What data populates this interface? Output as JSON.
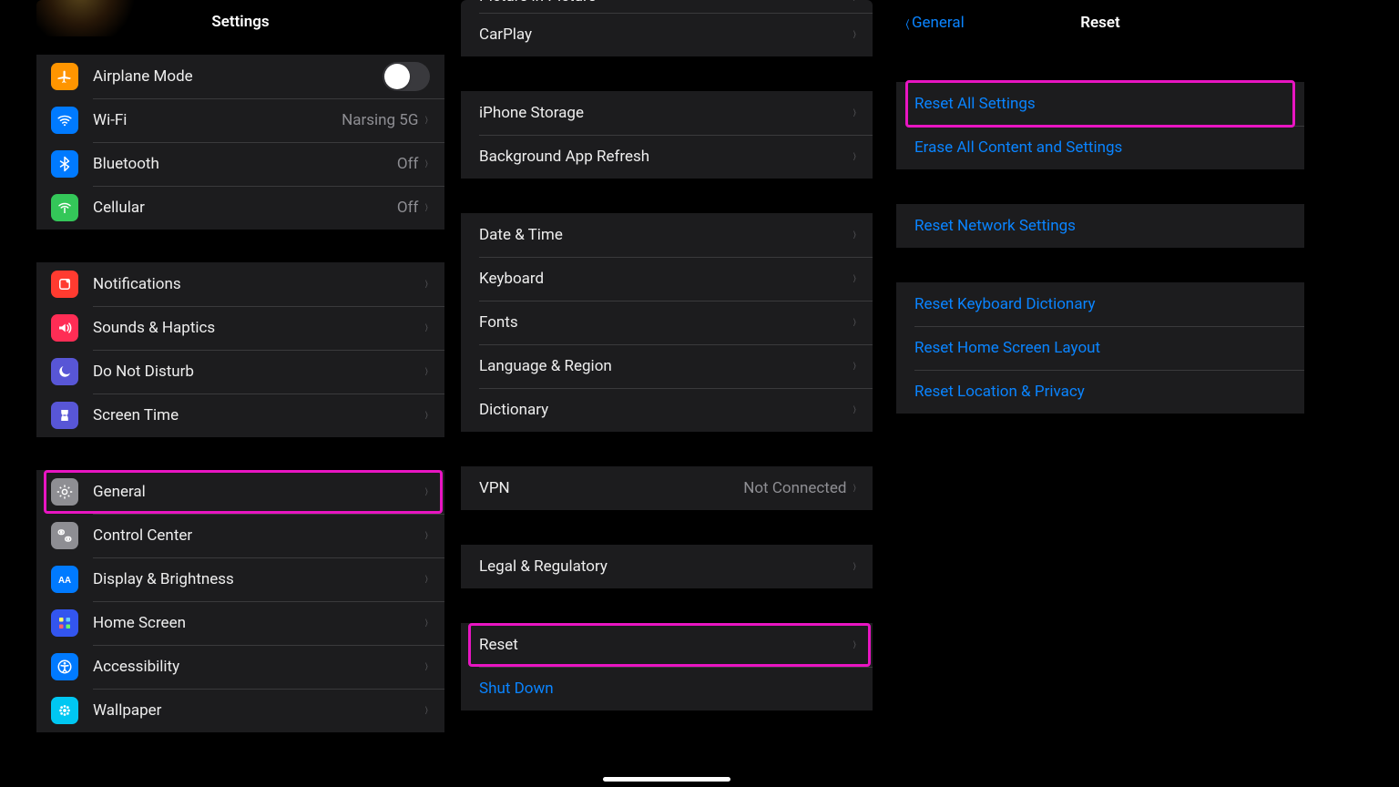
{
  "panel1": {
    "title": "Settings",
    "groups": [
      [
        {
          "id": "airplane",
          "label": "Airplane Mode",
          "icon": "airplane",
          "bg": "#ff9500",
          "toggle": true
        },
        {
          "id": "wifi",
          "label": "Wi-Fi",
          "icon": "wifi",
          "bg": "#007aff",
          "detail": "Narsing 5G",
          "chevron": true
        },
        {
          "id": "bluetooth",
          "label": "Bluetooth",
          "icon": "bluetooth",
          "bg": "#007aff",
          "detail": "Off",
          "chevron": true
        },
        {
          "id": "cellular",
          "label": "Cellular",
          "icon": "cellular",
          "bg": "#34c759",
          "detail": "Off",
          "chevron": true
        }
      ],
      [
        {
          "id": "notifications",
          "label": "Notifications",
          "icon": "notifications",
          "bg": "#ff3b30",
          "chevron": true
        },
        {
          "id": "sounds",
          "label": "Sounds & Haptics",
          "icon": "sounds",
          "bg": "#ff2d55",
          "chevron": true
        },
        {
          "id": "dnd",
          "label": "Do Not Disturb",
          "icon": "dnd",
          "bg": "#5856d6",
          "chevron": true
        },
        {
          "id": "screentime",
          "label": "Screen Time",
          "icon": "screentime",
          "bg": "#5856d6",
          "chevron": true
        }
      ],
      [
        {
          "id": "general",
          "label": "General",
          "icon": "general",
          "bg": "#8e8e93",
          "chevron": true,
          "highlight": true
        },
        {
          "id": "controlcenter",
          "label": "Control Center",
          "icon": "controlcenter",
          "bg": "#8e8e93",
          "chevron": true
        },
        {
          "id": "display",
          "label": "Display & Brightness",
          "icon": "display",
          "bg": "#007aff",
          "chevron": true
        },
        {
          "id": "homescreen",
          "label": "Home Screen",
          "icon": "homescreen",
          "bg": "#3355ee",
          "chevron": true
        },
        {
          "id": "accessibility",
          "label": "Accessibility",
          "icon": "accessibility",
          "bg": "#007aff",
          "chevron": true
        },
        {
          "id": "wallpaper",
          "label": "Wallpaper",
          "icon": "wallpaper",
          "bg": "#00c7f2",
          "chevron": true
        }
      ]
    ]
  },
  "panel2": {
    "groups": [
      [
        {
          "id": "pip",
          "label": "Picture in Picture",
          "chevron": true,
          "cut": true
        },
        {
          "id": "carplay",
          "label": "CarPlay",
          "chevron": true
        }
      ],
      [
        {
          "id": "storage",
          "label": "iPhone Storage",
          "chevron": true
        },
        {
          "id": "bgrefresh",
          "label": "Background App Refresh",
          "chevron": true
        }
      ],
      [
        {
          "id": "datetime",
          "label": "Date & Time",
          "chevron": true
        },
        {
          "id": "keyboard",
          "label": "Keyboard",
          "chevron": true
        },
        {
          "id": "fonts",
          "label": "Fonts",
          "chevron": true
        },
        {
          "id": "lang",
          "label": "Language & Region",
          "chevron": true
        },
        {
          "id": "dict",
          "label": "Dictionary",
          "chevron": true
        }
      ],
      [
        {
          "id": "vpn",
          "label": "VPN",
          "detail": "Not Connected",
          "chevron": true
        }
      ],
      [
        {
          "id": "legal",
          "label": "Legal & Regulatory",
          "chevron": true
        }
      ],
      [
        {
          "id": "reset",
          "label": "Reset",
          "chevron": true,
          "highlight": true
        },
        {
          "id": "shutdown",
          "label": "Shut Down",
          "blue": true
        }
      ]
    ]
  },
  "panel3": {
    "back_label": "General",
    "title": "Reset",
    "groups": [
      [
        {
          "id": "reset-all",
          "label": "Reset All Settings",
          "blue": true,
          "highlight": true
        },
        {
          "id": "erase",
          "label": "Erase All Content and Settings",
          "blue": true
        }
      ],
      [
        {
          "id": "reset-network",
          "label": "Reset Network Settings",
          "blue": true
        }
      ],
      [
        {
          "id": "reset-keyboard",
          "label": "Reset Keyboard Dictionary",
          "blue": true
        },
        {
          "id": "reset-home",
          "label": "Reset Home Screen Layout",
          "blue": true
        },
        {
          "id": "reset-loc",
          "label": "Reset Location & Privacy",
          "blue": true
        }
      ]
    ]
  },
  "colors": {
    "highlight": "#e815c2",
    "link_blue": "#0a84ff"
  }
}
